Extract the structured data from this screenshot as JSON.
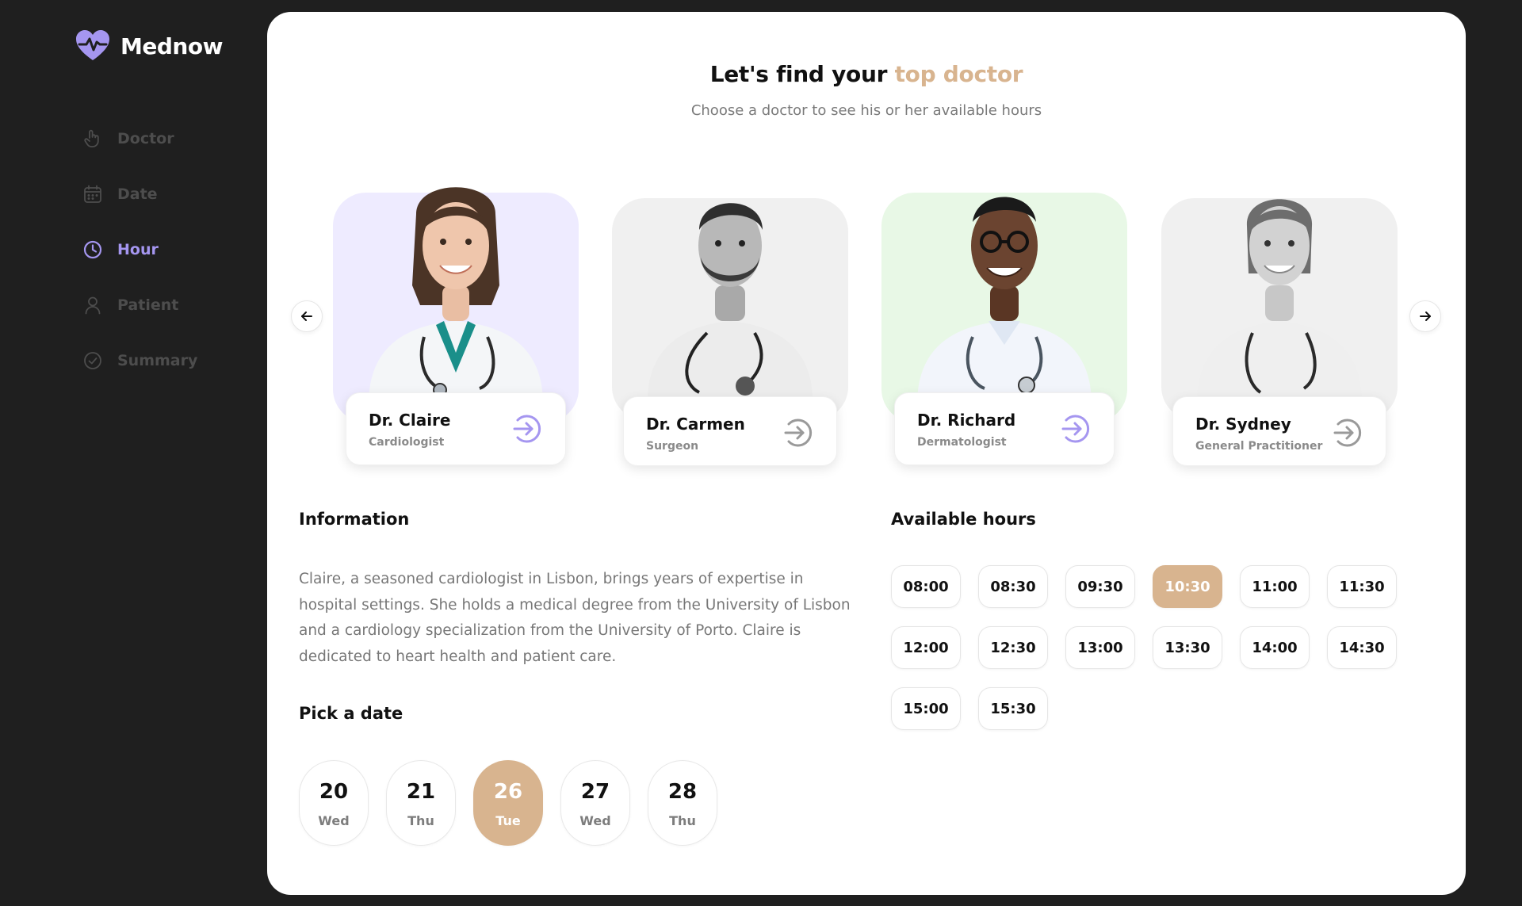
{
  "brand": {
    "name": "Mednow",
    "color": "#a596f0"
  },
  "nav": [
    {
      "label": "Doctor",
      "icon": "hand-pointer-icon",
      "active": false
    },
    {
      "label": "Date",
      "icon": "calendar-icon",
      "active": false
    },
    {
      "label": "Hour",
      "icon": "clock-icon",
      "active": true
    },
    {
      "label": "Patient",
      "icon": "user-icon",
      "active": false
    },
    {
      "label": "Summary",
      "icon": "check-circle-icon",
      "active": false
    }
  ],
  "header": {
    "title_main": "Let's find your ",
    "title_accent": "top doctor",
    "subtitle": "Choose a doctor to see his or her available hours"
  },
  "doctors": [
    {
      "name": "Dr. Claire",
      "role": "Cardiologist",
      "bg": "#eeebff",
      "highlight": true,
      "tone": "color"
    },
    {
      "name": "Dr. Carmen",
      "role": "Surgeon",
      "bg": "#f0f0f0",
      "highlight": false,
      "tone": "gray"
    },
    {
      "name": "Dr. Richard",
      "role": "Dermatologist",
      "bg": "#e8f8e6",
      "highlight": true,
      "tone": "color"
    },
    {
      "name": "Dr. Sydney",
      "role": "General Practitioner",
      "bg": "#f0f0f0",
      "highlight": false,
      "tone": "gray"
    }
  ],
  "information": {
    "heading": "Information",
    "text": "Claire, a seasoned cardiologist in Lisbon, brings years of expertise in hospital settings. She holds a medical degree from the University of Lisbon and a cardiology specialization from the University of Porto. Claire is dedicated to heart health and patient care."
  },
  "date_section": {
    "heading": "Pick a date",
    "dates": [
      {
        "num": "20",
        "day": "Wed",
        "selected": false
      },
      {
        "num": "21",
        "day": "Thu",
        "selected": false
      },
      {
        "num": "26",
        "day": "Tue",
        "selected": true
      },
      {
        "num": "27",
        "day": "Wed",
        "selected": false
      },
      {
        "num": "28",
        "day": "Thu",
        "selected": false
      }
    ]
  },
  "hours_section": {
    "heading": "Available hours",
    "hours": [
      "08:00",
      "08:30",
      "09:30",
      "10:30",
      "11:00",
      "11:30",
      "12:00",
      "12:30",
      "13:00",
      "13:30",
      "14:00",
      "14:30",
      "15:00",
      "15:30"
    ],
    "selected": "10:30"
  },
  "colors": {
    "accent": "#d8b48f",
    "purple": "#a596f0",
    "background": "#1f1f1f"
  }
}
